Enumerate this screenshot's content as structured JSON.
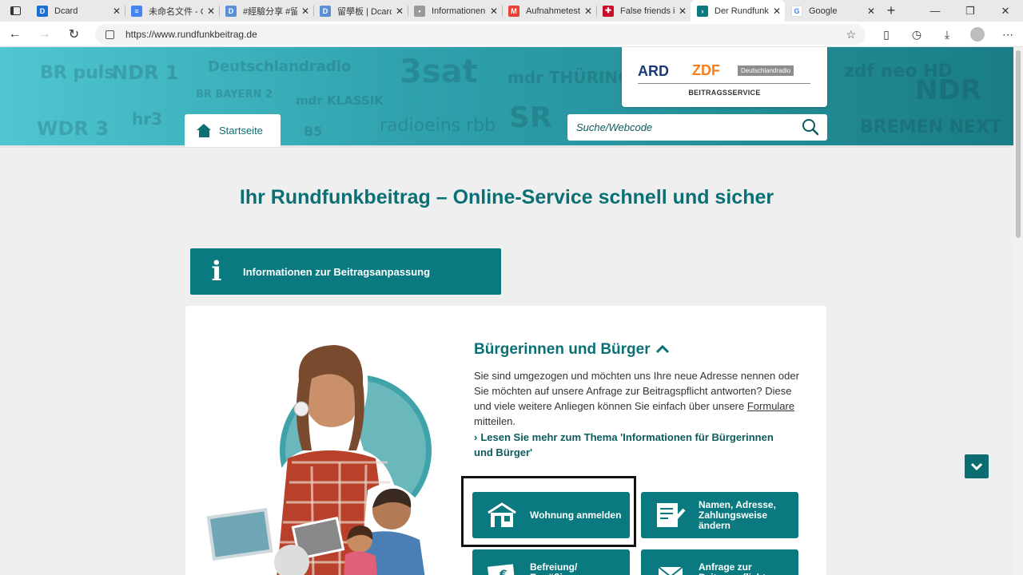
{
  "browser": {
    "tabs": [
      {
        "title": "Dcard",
        "fav_color": "#1a6fd4",
        "fav_glyph": "D",
        "active": false
      },
      {
        "title": "未命名文件 - G",
        "fav_color": "#4285f4",
        "fav_glyph": "≡",
        "active": false
      },
      {
        "title": "#經驗分享 #留",
        "fav_color": "#5b8ed6",
        "fav_glyph": "D",
        "active": false
      },
      {
        "title": "留學板 | Dcard",
        "fav_color": "#5b8ed6",
        "fav_glyph": "D",
        "active": false
      },
      {
        "title": "Informationen",
        "fav_color": "#9a9a9a",
        "fav_glyph": "•",
        "active": false
      },
      {
        "title": "Aufnahmetest",
        "fav_color": "#ea4335",
        "fav_glyph": "M",
        "active": false
      },
      {
        "title": "False friends in",
        "fav_color": "#c8102e",
        "fav_glyph": "✚",
        "active": false
      },
      {
        "title": "Der Rundfunkb",
        "fav_color": "#0a7a80",
        "fav_glyph": "›",
        "active": true
      },
      {
        "title": "Google",
        "fav_color": "#ffffff",
        "fav_glyph": "G",
        "active": false
      }
    ],
    "new_tab_glyph": "+",
    "close_glyph": "✕",
    "window_controls": [
      "—",
      "❐",
      "✕"
    ],
    "url": "https://www.rundfunkbeitrag.de"
  },
  "header": {
    "logos": {
      "ard": "ARD",
      "zdf": "ZDF",
      "deutschlandradio": "Deutschlandradio",
      "service": "BEITRAGSSERVICE"
    },
    "home_tab": "Startseite",
    "search_placeholder": "Suche/Webcode",
    "watermarks": [
      "BR puls",
      "NDR 1",
      "Deutschlandradio",
      "3sat",
      "mdr THÜRINGEN",
      "BR BAYERN 2",
      "mdr KLASSIK",
      "WDR 3",
      "hr3",
      "radioeins rbb",
      "SR",
      "B5",
      "zdf neo HD",
      "NDR",
      "BREMEN NEXT"
    ]
  },
  "main": {
    "title": "Ihr Rundfunkbeitrag – Online-Service schnell und sicher",
    "info_button": "Informationen zur Beitragsanpassung",
    "section": {
      "title": "Bürgerinnen und Bürger",
      "text_before_link": "Sie sind umgezogen und möchten uns Ihre neue Adresse nennen oder Sie möchten auf unsere Anfrage zur Beitragspflicht antworten? Diese und viele weitere Anliegen können Sie einfach über unsere ",
      "link": "Formulare",
      "text_after_link": " mitteilen.",
      "more": "Lesen Sie mehr zum Thema 'Informationen für Bürgerinnen und Bürger'"
    },
    "tiles": [
      "Wohnung anmelden",
      "Namen, Adresse, Zahlungsweise ändern",
      "Befreiung/ Ermäßigung",
      "Anfrage zur Beitragspflicht"
    ]
  },
  "colors": {
    "teal": "#0a7a80",
    "teal_dark": "#0a7075",
    "banner_light": "#4fc6d1",
    "banner_dark": "#1a7d86"
  },
  "icons": [
    "sidebar-icon",
    "back-arrow-icon",
    "forward-arrow-icon",
    "refresh-icon",
    "lock-icon",
    "favorites-add-icon",
    "collections-icon",
    "history-icon",
    "download-icon",
    "profile-icon",
    "more-icon",
    "home-icon",
    "search-icon",
    "info-icon",
    "chevron-up-icon",
    "chevron-right-icon",
    "house-icon",
    "form-pen-icon",
    "money-icon",
    "letter-icon",
    "chevron-down-icon"
  ]
}
